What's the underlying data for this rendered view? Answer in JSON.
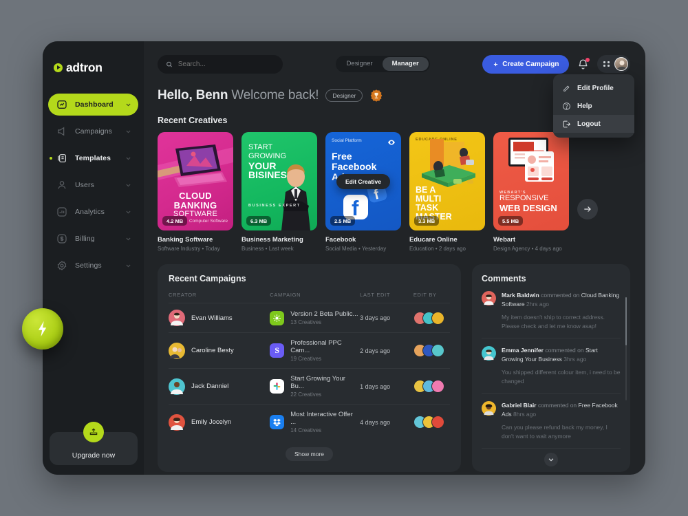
{
  "brand": {
    "name": "adtron",
    "accent": "#b4d91b"
  },
  "sidebar": {
    "items": [
      {
        "label": "Dashboard",
        "icon": "dashboard-icon",
        "state": "active"
      },
      {
        "label": "Campaigns",
        "icon": "megaphone-icon",
        "state": "normal"
      },
      {
        "label": "Templates",
        "icon": "templates-icon",
        "state": "highlight"
      },
      {
        "label": "Users",
        "icon": "user-icon",
        "state": "normal"
      },
      {
        "label": "Analytics",
        "icon": "chart-icon",
        "state": "normal"
      },
      {
        "label": "Billing",
        "icon": "dollar-icon",
        "state": "normal"
      },
      {
        "label": "Settings",
        "icon": "gear-icon",
        "state": "normal"
      }
    ],
    "upgrade": {
      "label": "Upgrade now",
      "icon": "upload-icon"
    },
    "float_button_icon": "lightning-bolt-icon"
  },
  "topbar": {
    "search_placeholder": "Search...",
    "search_value": "",
    "segments": [
      {
        "label": "Designer",
        "selected": false
      },
      {
        "label": "Manager",
        "selected": true
      }
    ],
    "create_button": "Create Campaign",
    "create_button_color": "#3a5ce0",
    "notification_badge": true
  },
  "profile_menu": {
    "items": [
      {
        "label": "Edit Profile",
        "icon": "pencil-icon",
        "selected": false
      },
      {
        "label": "Help",
        "icon": "question-icon",
        "selected": false
      },
      {
        "label": "Logout",
        "icon": "logout-icon",
        "selected": true
      }
    ]
  },
  "greeting": {
    "name": "Hello, Benn",
    "message": "Welcome back!",
    "role_chip": "Designer",
    "badge_icon": "trophy-icon"
  },
  "sections": {
    "recent_creatives": "Recent Creatives",
    "recent_campaigns": "Recent Campaigns",
    "comments": "Comments"
  },
  "creatives": [
    {
      "title": "Banking Software",
      "meta": "Software Industry  •  Today",
      "size": "4.2 MB",
      "thumb_meta": "Computer Software",
      "headline": [
        "CLOUD",
        "BANKING",
        "SOFTWARE"
      ],
      "theme": "t1",
      "hover": false
    },
    {
      "title": "Business Marketing",
      "meta": "Business  •  Last week",
      "size": "6.3 MB",
      "thumb_meta": "",
      "headline": [
        "START",
        "GROWING",
        "YOUR",
        "BISINESS"
      ],
      "kicker": "BUSINESS EXPERT",
      "theme": "t2",
      "hover": false
    },
    {
      "title": "Facebook",
      "meta": "Social Media  •  Yesterday",
      "size": "2.5 MB",
      "thumb_meta": "",
      "kicker": "Social Platform",
      "headline": [
        "Free",
        "Facebook",
        "Ads"
      ],
      "theme": "t3",
      "hover": true,
      "hover_label": "Edit Creative",
      "eye_icon": "eye-icon"
    },
    {
      "title": "Educare Online",
      "meta": "Education  •  2 days ago",
      "size": "3.3 MB",
      "thumb_meta": "",
      "kicker": "EDUCARE ONLINE",
      "headline": [
        "BE A",
        "MULTI",
        "TASK",
        "MASTER"
      ],
      "theme": "t4",
      "hover": false
    },
    {
      "title": "Webart",
      "meta": "Design Agency  •  4 days ago",
      "size": "5.5 MB",
      "thumb_meta": "",
      "kicker": "WEBART'S",
      "headline": [
        "RESPONSIVE",
        "WEB DESIGN"
      ],
      "theme": "t5",
      "hover": false
    }
  ],
  "carousel_next_icon": "arrow-right-icon",
  "campaigns": {
    "headers": [
      "CREATOR",
      "CAMPAIGN",
      "LAST EDIT",
      "EDIT BY"
    ],
    "rows": [
      {
        "creator": "Evan Williams",
        "creator_color": "#e06a78",
        "campaign": "Version 2 Beta Public...",
        "creatives": "13 Creatives",
        "app_color": "#7ec81c",
        "app_icon": "zoom-icon",
        "last_edit": "3 days ago",
        "editors": [
          "#e0736d",
          "#46c3c8",
          "#eab52a"
        ]
      },
      {
        "creator": "Caroline Besty",
        "creator_color": "#e8b933",
        "campaign": "Professional PPC Cam...",
        "creatives": "19 Creatives",
        "app_color": "#6a5cf5",
        "app_icon": "skype-icon",
        "last_edit": "2 days ago",
        "editors": [
          "#e6a35c",
          "#2f58c0",
          "#58c7cc"
        ]
      },
      {
        "creator": "Jack Danniel",
        "creator_color": "#4fc4cf",
        "campaign": "Start Growing Your Bu...",
        "creatives": "22 Creatives",
        "app_color": "#ffffff",
        "app_icon": "slack-icon",
        "last_edit": "1 days ago",
        "editors": [
          "#e8c342",
          "#5fb9dd",
          "#f07ab0"
        ]
      },
      {
        "creator": "Emily Jocelyn",
        "creator_color": "#e0533f",
        "campaign": "Most Interactive Offer ...",
        "creatives": "14 Creatives",
        "app_color": "#1a7ff0",
        "app_icon": "dropbox-icon",
        "last_edit": "4 days ago",
        "editors": [
          "#63c6d8",
          "#ecc33a",
          "#e04a3a"
        ]
      }
    ],
    "show_more": "Show more"
  },
  "comments": {
    "items": [
      {
        "author": "Mark Baldwin",
        "action": "commented on",
        "object": "Cloud Banking Software",
        "time": "2hrs ago",
        "text": "My item  doesn't ship to correct address. Please check and let me know asap!",
        "avatar_color": "#e0645c"
      },
      {
        "author": "Emma Jennifer",
        "action": "commented on",
        "object": "Start Growing Your Business",
        "time": "3hrs ago",
        "text": "You shipped different colour item, i need to be  changed",
        "avatar_color": "#45c6cf"
      },
      {
        "author": "Gabriel Blair",
        "action": "commented on",
        "object": "Free Facebook Ads",
        "time": "8hrs ago",
        "text": "Can you please refund back my money, I don't want to wait anymore",
        "avatar_color": "#eeb62c"
      }
    ],
    "more_icon": "chevron-down-icon"
  }
}
